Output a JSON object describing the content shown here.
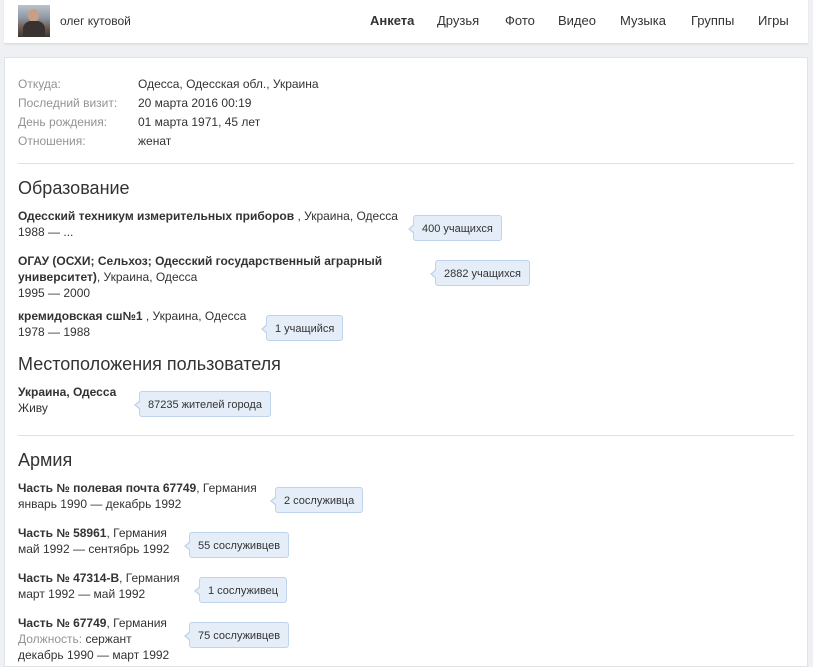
{
  "header": {
    "user_name": "олег кутовой",
    "nav": [
      "Анкета",
      "Друзья",
      "Фото",
      "Видео",
      "Музыка",
      "Группы",
      "Игры"
    ],
    "active_tab": "Анкета"
  },
  "info": [
    {
      "label": "Откуда:",
      "value": "Одесса, Одесская обл., Украина"
    },
    {
      "label": "Последний визит:",
      "value": "20 марта 2016 00:19"
    },
    {
      "label": "День рождения:",
      "value": "01 марта 1971, 45 лет"
    },
    {
      "label": "Отношения:",
      "value": "женат"
    }
  ],
  "education": {
    "title": "Образование",
    "items": [
      {
        "name": "Одесский техникум измерительных приборов",
        "location": " , Украина, Одесса",
        "years": "1988 — ...",
        "count": "400 учащихся"
      },
      {
        "name_line1": "ОГАУ (ОСХИ; Сельхоз; Одесский государственный аграрный",
        "name_line2": "университет)",
        "location": ", Украина, Одесса",
        "years": "1995 — 2000",
        "count": "2882 учащихся"
      },
      {
        "name": "кремидовская сш№1",
        "location": " , Украина, Одесса",
        "years": "1978 — 1988",
        "count": "1 учащийся"
      }
    ]
  },
  "locations": {
    "title": "Местоположения пользователя",
    "items": [
      {
        "name": "Украина, Одесса",
        "status": "Живу",
        "count": "87235 жителей города"
      }
    ]
  },
  "army": {
    "title": "Армия",
    "position_label": "Должность:",
    "items": [
      {
        "name": "Часть № полевая почта 67749",
        "location": ", Германия",
        "dates": "январь 1990 — декабрь 1992",
        "count": "2 сослуживца"
      },
      {
        "name": "Часть № 58961",
        "location": ", Германия",
        "dates": "май 1992 — сентябрь 1992",
        "count": "55 сослуживцев"
      },
      {
        "name": "Часть № 47314-В",
        "location": ", Германия",
        "dates": "март 1992 — май 1992",
        "count": "1 сослуживец"
      },
      {
        "name": "Часть № 67749",
        "location": ", Германия",
        "position": "сержант",
        "dates": "декабрь 1990 — март 1992",
        "count": "75 сослуживцев"
      }
    ]
  },
  "colors": {
    "bubble_bg": "#e5eef8",
    "bubble_border": "#bfd3ea",
    "label_gray": "#939393"
  }
}
